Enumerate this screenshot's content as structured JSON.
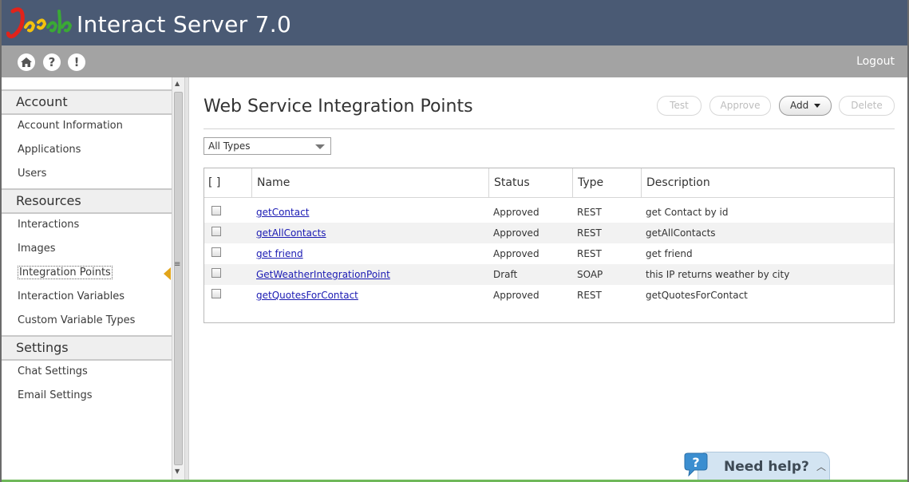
{
  "app": {
    "title": "Interact Server 7.0",
    "logo_text": "Jacada"
  },
  "toolbar": {
    "logout": "Logout",
    "icons": [
      "home-icon",
      "help-icon",
      "alert-icon"
    ]
  },
  "sidebar": {
    "sections": [
      {
        "label": "Account",
        "items": [
          "Account Information",
          "Applications",
          "Users"
        ]
      },
      {
        "label": "Resources",
        "items": [
          "Interactions",
          "Images",
          "Integration Points",
          "Interaction Variables",
          "Custom Variable Types"
        ]
      },
      {
        "label": "Settings",
        "items": [
          "Chat Settings",
          "Email Settings"
        ]
      }
    ],
    "active_item": "Integration Points"
  },
  "main": {
    "title": "Web Service Integration Points",
    "buttons": {
      "test": "Test",
      "approve": "Approve",
      "add": "Add",
      "delete": "Delete"
    },
    "filter": {
      "selected": "All Types"
    },
    "table": {
      "headers": [
        "[ ]",
        "Name",
        "Status",
        "Type",
        "Description"
      ],
      "rows": [
        {
          "name": "getContact",
          "status": "Approved",
          "type": "REST",
          "description": "get Contact by id"
        },
        {
          "name": "getAllContacts",
          "status": "Approved",
          "type": "REST",
          "description": "getAllContacts"
        },
        {
          "name": "get friend",
          "status": "Approved",
          "type": "REST",
          "description": "get friend"
        },
        {
          "name": "GetWeatherIntegrationPoint",
          "status": "Draft",
          "type": "SOAP",
          "description": "this IP returns weather by city"
        },
        {
          "name": "getQuotesForContact",
          "status": "Approved",
          "type": "REST",
          "description": "getQuotesForContact"
        }
      ]
    }
  },
  "help": {
    "label": "Need help?"
  },
  "colors": {
    "header": "#4a5a74",
    "toolbar": "#a3a3a3",
    "link": "#1a1ab3",
    "active_marker": "#e2a51b"
  }
}
